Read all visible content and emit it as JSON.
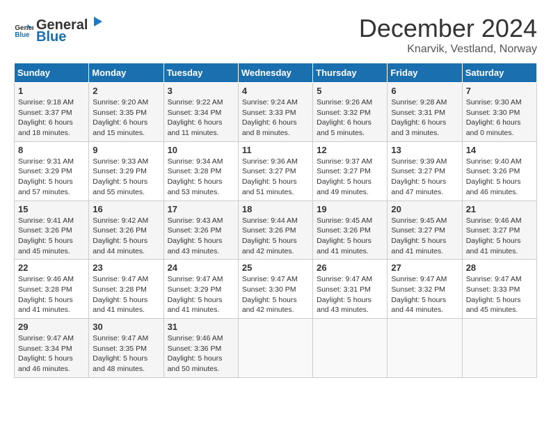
{
  "header": {
    "logo_general": "General",
    "logo_blue": "Blue",
    "month_title": "December 2024",
    "location": "Knarvik, Vestland, Norway"
  },
  "days_of_week": [
    "Sunday",
    "Monday",
    "Tuesday",
    "Wednesday",
    "Thursday",
    "Friday",
    "Saturday"
  ],
  "weeks": [
    [
      {
        "day": "1",
        "sunrise": "9:18 AM",
        "sunset": "3:37 PM",
        "daylight": "6 hours and 18 minutes."
      },
      {
        "day": "2",
        "sunrise": "9:20 AM",
        "sunset": "3:35 PM",
        "daylight": "6 hours and 15 minutes."
      },
      {
        "day": "3",
        "sunrise": "9:22 AM",
        "sunset": "3:34 PM",
        "daylight": "6 hours and 11 minutes."
      },
      {
        "day": "4",
        "sunrise": "9:24 AM",
        "sunset": "3:33 PM",
        "daylight": "6 hours and 8 minutes."
      },
      {
        "day": "5",
        "sunrise": "9:26 AM",
        "sunset": "3:32 PM",
        "daylight": "6 hours and 5 minutes."
      },
      {
        "day": "6",
        "sunrise": "9:28 AM",
        "sunset": "3:31 PM",
        "daylight": "6 hours and 3 minutes."
      },
      {
        "day": "7",
        "sunrise": "9:30 AM",
        "sunset": "3:30 PM",
        "daylight": "6 hours and 0 minutes."
      }
    ],
    [
      {
        "day": "8",
        "sunrise": "9:31 AM",
        "sunset": "3:29 PM",
        "daylight": "5 hours and 57 minutes."
      },
      {
        "day": "9",
        "sunrise": "9:33 AM",
        "sunset": "3:29 PM",
        "daylight": "5 hours and 55 minutes."
      },
      {
        "day": "10",
        "sunrise": "9:34 AM",
        "sunset": "3:28 PM",
        "daylight": "5 hours and 53 minutes."
      },
      {
        "day": "11",
        "sunrise": "9:36 AM",
        "sunset": "3:27 PM",
        "daylight": "5 hours and 51 minutes."
      },
      {
        "day": "12",
        "sunrise": "9:37 AM",
        "sunset": "3:27 PM",
        "daylight": "5 hours and 49 minutes."
      },
      {
        "day": "13",
        "sunrise": "9:39 AM",
        "sunset": "3:27 PM",
        "daylight": "5 hours and 47 minutes."
      },
      {
        "day": "14",
        "sunrise": "9:40 AM",
        "sunset": "3:26 PM",
        "daylight": "5 hours and 46 minutes."
      }
    ],
    [
      {
        "day": "15",
        "sunrise": "9:41 AM",
        "sunset": "3:26 PM",
        "daylight": "5 hours and 45 minutes."
      },
      {
        "day": "16",
        "sunrise": "9:42 AM",
        "sunset": "3:26 PM",
        "daylight": "5 hours and 44 minutes."
      },
      {
        "day": "17",
        "sunrise": "9:43 AM",
        "sunset": "3:26 PM",
        "daylight": "5 hours and 43 minutes."
      },
      {
        "day": "18",
        "sunrise": "9:44 AM",
        "sunset": "3:26 PM",
        "daylight": "5 hours and 42 minutes."
      },
      {
        "day": "19",
        "sunrise": "9:45 AM",
        "sunset": "3:26 PM",
        "daylight": "5 hours and 41 minutes."
      },
      {
        "day": "20",
        "sunrise": "9:45 AM",
        "sunset": "3:27 PM",
        "daylight": "5 hours and 41 minutes."
      },
      {
        "day": "21",
        "sunrise": "9:46 AM",
        "sunset": "3:27 PM",
        "daylight": "5 hours and 41 minutes."
      }
    ],
    [
      {
        "day": "22",
        "sunrise": "9:46 AM",
        "sunset": "3:28 PM",
        "daylight": "5 hours and 41 minutes."
      },
      {
        "day": "23",
        "sunrise": "9:47 AM",
        "sunset": "3:28 PM",
        "daylight": "5 hours and 41 minutes."
      },
      {
        "day": "24",
        "sunrise": "9:47 AM",
        "sunset": "3:29 PM",
        "daylight": "5 hours and 41 minutes."
      },
      {
        "day": "25",
        "sunrise": "9:47 AM",
        "sunset": "3:30 PM",
        "daylight": "5 hours and 42 minutes."
      },
      {
        "day": "26",
        "sunrise": "9:47 AM",
        "sunset": "3:31 PM",
        "daylight": "5 hours and 43 minutes."
      },
      {
        "day": "27",
        "sunrise": "9:47 AM",
        "sunset": "3:32 PM",
        "daylight": "5 hours and 44 minutes."
      },
      {
        "day": "28",
        "sunrise": "9:47 AM",
        "sunset": "3:33 PM",
        "daylight": "5 hours and 45 minutes."
      }
    ],
    [
      {
        "day": "29",
        "sunrise": "9:47 AM",
        "sunset": "3:34 PM",
        "daylight": "5 hours and 46 minutes."
      },
      {
        "day": "30",
        "sunrise": "9:47 AM",
        "sunset": "3:35 PM",
        "daylight": "5 hours and 48 minutes."
      },
      {
        "day": "31",
        "sunrise": "9:46 AM",
        "sunset": "3:36 PM",
        "daylight": "5 hours and 50 minutes."
      },
      null,
      null,
      null,
      null
    ]
  ]
}
